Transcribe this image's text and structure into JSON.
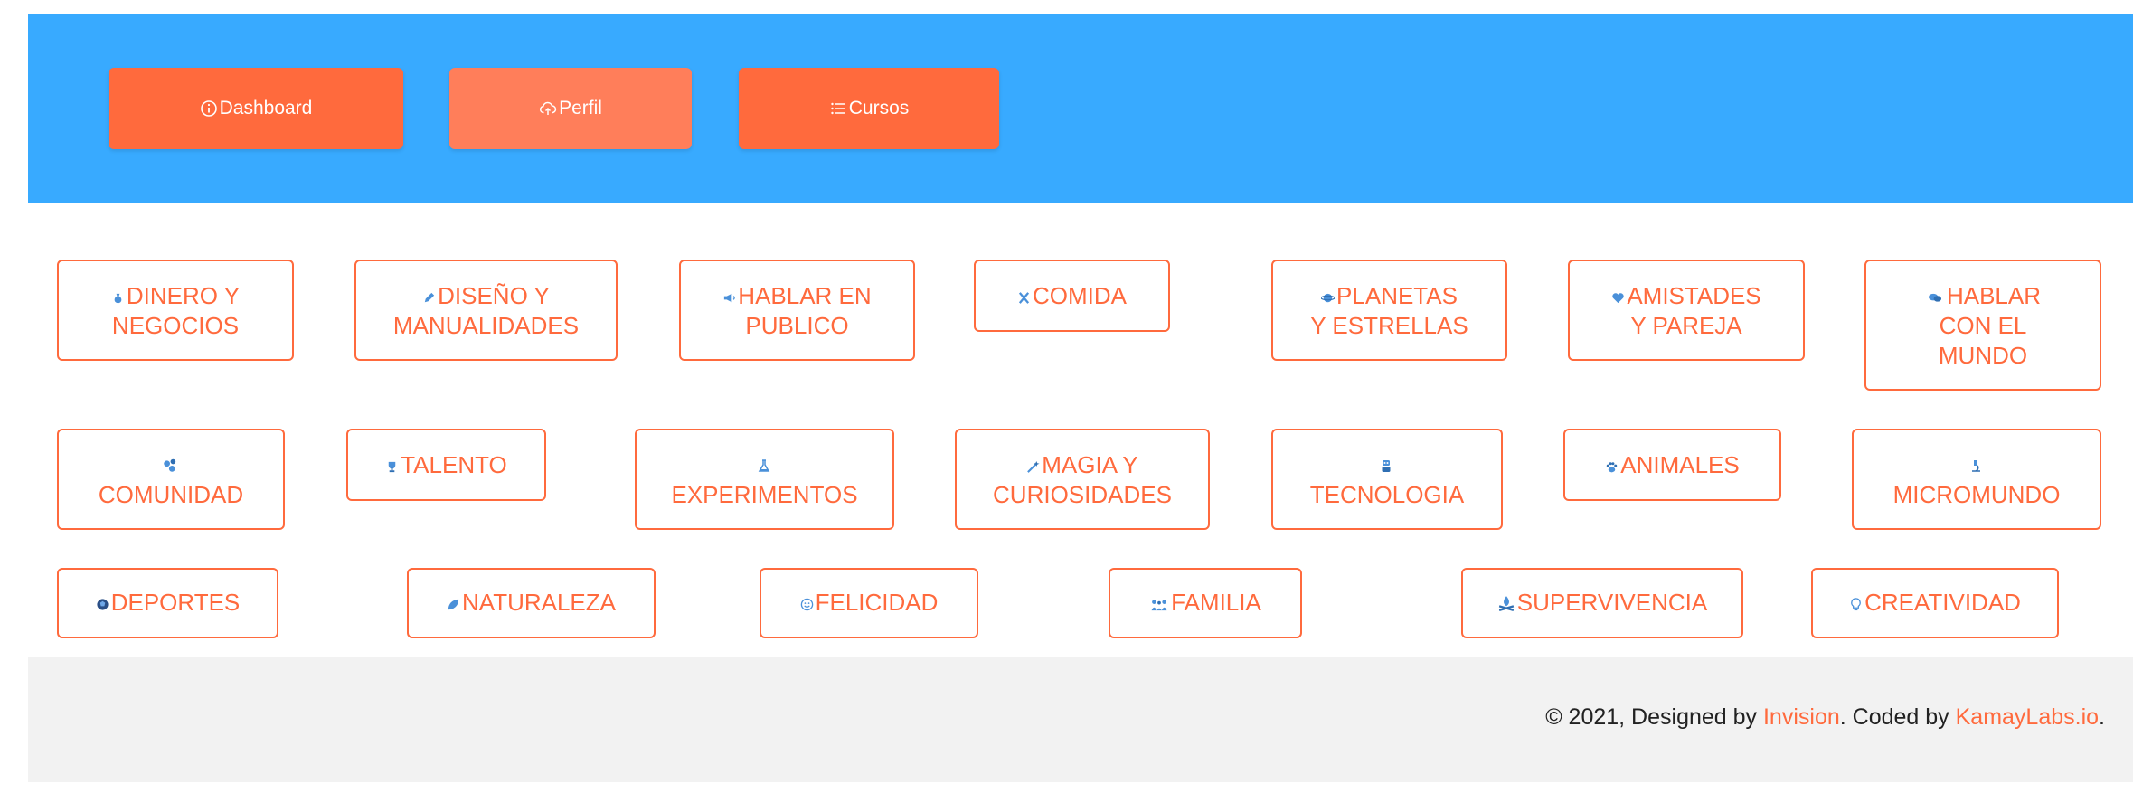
{
  "colors": {
    "header_bg": "#38aaff",
    "accent": "#ff6a3d",
    "accent_light": "#ff7e5a",
    "footer_bg": "#f2f2f2"
  },
  "nav": {
    "dashboard": {
      "label": "Dashboard",
      "icon": "info-icon"
    },
    "perfil": {
      "label": "Perfil",
      "icon": "cloud-upload-icon"
    },
    "cursos": {
      "label": "Cursos",
      "icon": "list-icon"
    }
  },
  "topics": {
    "dinero": {
      "line1": "DINERO Y",
      "line2": "NEGOCIOS",
      "icon": "money-bag-icon"
    },
    "diseno": {
      "line1": "DISEÑO Y",
      "line2": "MANUALIDADES",
      "icon": "pencil-icon"
    },
    "hablar": {
      "line1": "HABLAR EN",
      "line2": "PUBLICO",
      "icon": "megaphone-icon"
    },
    "comida": {
      "line1": "COMIDA",
      "icon": "utensils-icon"
    },
    "planetas": {
      "line1": "PLANETAS",
      "line2": "Y ESTRELLAS",
      "icon": "planet-icon"
    },
    "amistades": {
      "line1": "AMISTADES",
      "line2": "Y PAREJA",
      "icon": "heart-icon"
    },
    "hablar_mundo": {
      "line1": "HABLAR",
      "line2": "CON EL",
      "line3": "MUNDO",
      "icon": "speech-bubbles-icon"
    },
    "comunidad": {
      "line1": "COMUNIDAD",
      "icon": "community-icon"
    },
    "talento": {
      "line1": "TALENTO",
      "icon": "trophy-icon"
    },
    "experimentos": {
      "line1": "EXPERIMENTOS",
      "icon": "flask-icon"
    },
    "magia": {
      "line1": "MAGIA Y",
      "line2": "CURIOSIDADES",
      "icon": "magic-wand-icon"
    },
    "tecnologia": {
      "line1": "TECNOLOGIA",
      "icon": "robot-icon"
    },
    "animales": {
      "line1": "ANIMALES",
      "icon": "paw-icon"
    },
    "micromundo": {
      "line1": "MICROMUNDO",
      "icon": "microscope-icon"
    },
    "deportes": {
      "line1": "DEPORTES",
      "icon": "ball-icon"
    },
    "naturaleza": {
      "line1": "NATURALEZA",
      "icon": "leaf-icon"
    },
    "felicidad": {
      "line1": "FELICIDAD",
      "icon": "smile-icon"
    },
    "familia": {
      "line1": "FAMILIA",
      "icon": "family-icon"
    },
    "supervivencia": {
      "line1": "SUPERVIVENCIA",
      "icon": "campfire-icon"
    },
    "creatividad": {
      "line1": "CREATIVIDAD",
      "icon": "lightbulb-icon"
    }
  },
  "footer": {
    "prefix": "© 2021, Designed by ",
    "designer": "Invision",
    "middle": ". Coded by ",
    "coder": "KamayLabs.io",
    "suffix": "."
  }
}
